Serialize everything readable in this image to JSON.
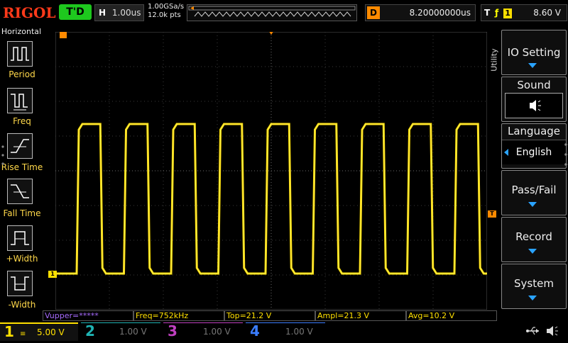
{
  "brand": "RIGOL",
  "top": {
    "status": "T'D",
    "horizontal_key": "H",
    "horizontal_scale": "1.00us",
    "sample_rate": "1.00GSa/s",
    "memory_depth": "12.0k pts",
    "delay_key": "D",
    "delay_value": "8.20000000us",
    "trigger_key": "T",
    "trigger_source": "1",
    "trigger_level": "8.60 V"
  },
  "left_menu": {
    "title": "Horizontal",
    "items": [
      {
        "label": "Period"
      },
      {
        "label": "Freq"
      },
      {
        "label": "Rise Time"
      },
      {
        "label": "Fall Time"
      },
      {
        "label": "+Width"
      },
      {
        "label": "-Width"
      }
    ]
  },
  "right_menu": {
    "tab": "Utility",
    "items": [
      {
        "label": "IO Setting"
      },
      {
        "label": "Sound"
      },
      {
        "label": "Language",
        "value": "English"
      },
      {
        "label": "Pass/Fail"
      },
      {
        "label": "Record"
      },
      {
        "label": "System"
      }
    ]
  },
  "measurements": [
    "Vupper=*****",
    "Freq=752kHz",
    "Top=21.2 V",
    "Ampl=21.3 V",
    "Avg=10.2 V"
  ],
  "channels": [
    {
      "num": "1",
      "scale": "5.00 V",
      "color": "#ffe000"
    },
    {
      "num": "2",
      "scale": "1.00 V",
      "color": "#1fb3b3"
    },
    {
      "num": "3",
      "scale": "1.00 V",
      "color": "#c040c0"
    },
    {
      "num": "4",
      "scale": "1.00 V",
      "color": "#3a7dff"
    }
  ],
  "markers": {
    "ch1": "1",
    "trigger_level": "T"
  },
  "waveform": {
    "channel": "1",
    "type": "square",
    "cycles_visible": 9
  },
  "colors": {
    "ch1": "#ffe000",
    "accent": "#2aa3ff",
    "trigger": "#ff8a00",
    "brand": "#ff3a1a"
  }
}
